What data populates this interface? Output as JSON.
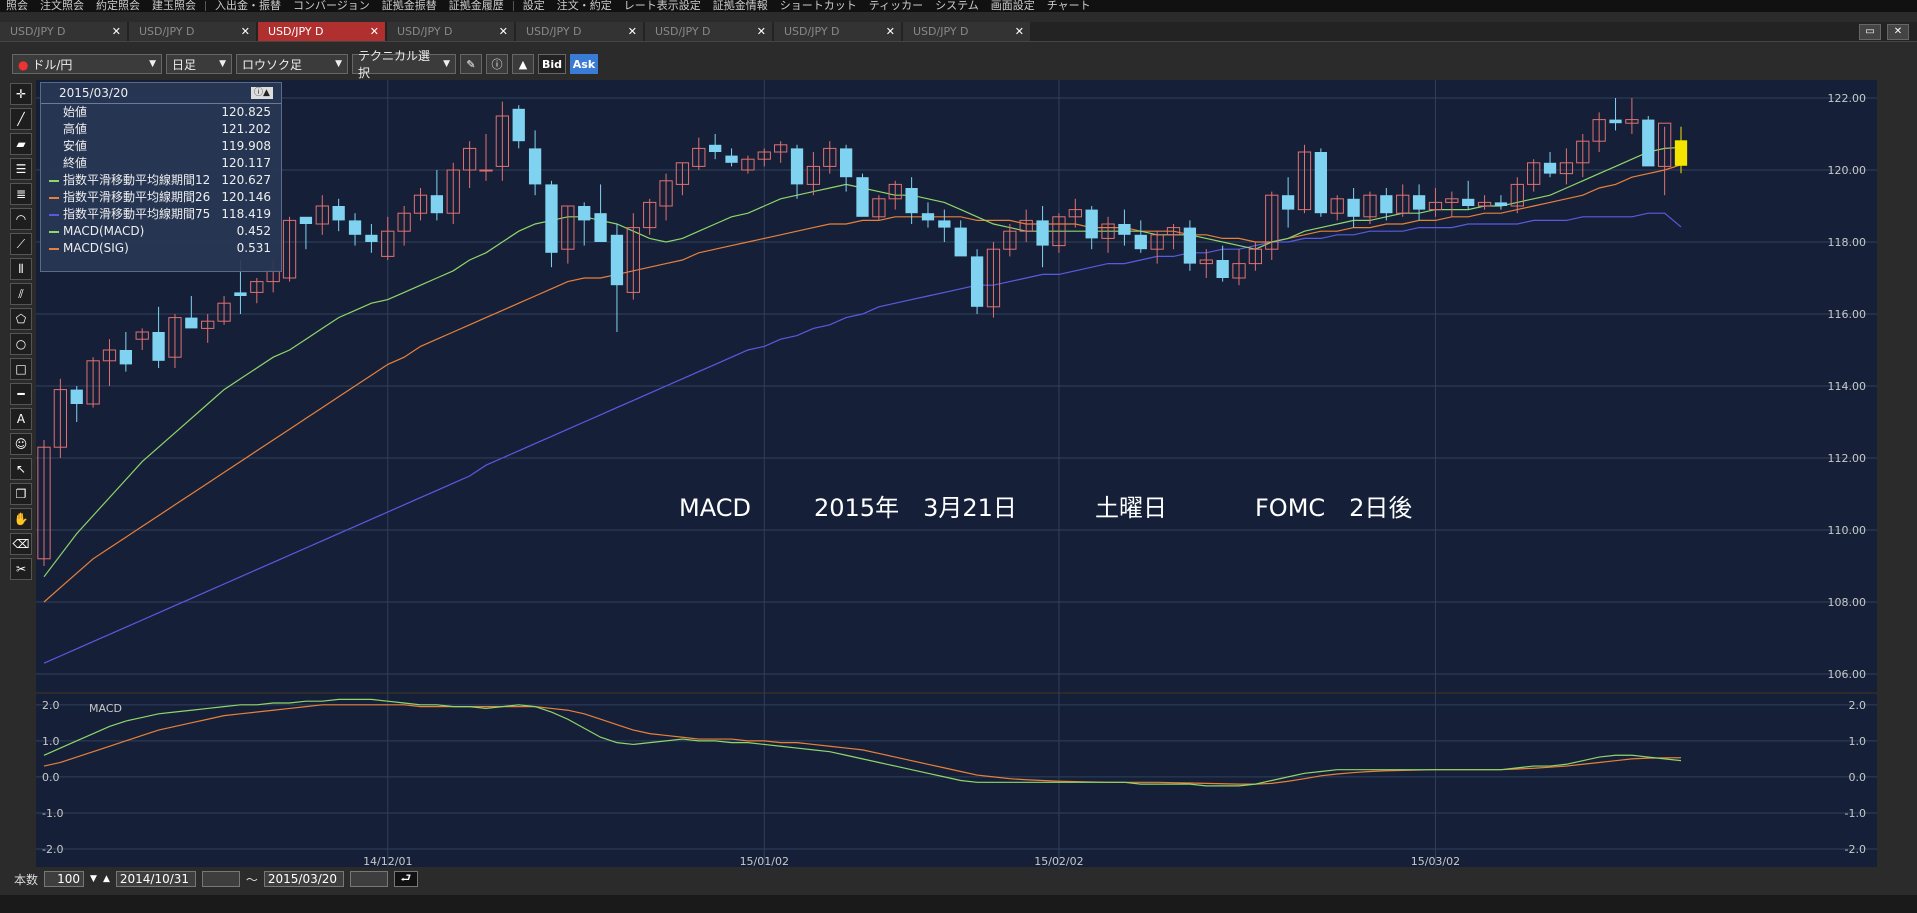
{
  "menu": [
    "照会",
    "注文照会",
    "約定照会",
    "建玉照会",
    "入出金・振替",
    "コンバージョン",
    "証拠金振替",
    "証拠金履歴",
    "設定",
    "注文・約定",
    "レート表示設定",
    "証拠金情報",
    "ショートカット",
    "ティッカー",
    "システム",
    "画面設定",
    "チャート"
  ],
  "tabs": [
    {
      "label": "USD/JPY D",
      "active": false
    },
    {
      "label": "USD/JPY D",
      "active": false
    },
    {
      "label": "USD/JPY D",
      "active": true
    },
    {
      "label": "USD/JPY D",
      "active": false
    },
    {
      "label": "USD/JPY D",
      "active": false
    },
    {
      "label": "USD/JPY D",
      "active": false
    },
    {
      "label": "USD/JPY D",
      "active": false
    },
    {
      "label": "USD/JPY D",
      "active": false
    }
  ],
  "toolbar": {
    "pair": "ドル/円",
    "period": "日足",
    "chart_type": "ロウソク足",
    "technical": "テクニカル選択",
    "bid": "Bid",
    "ask": "Ask"
  },
  "info": {
    "date": "2015/03/20",
    "rows": [
      {
        "label": "始値",
        "value": "120.825",
        "color": ""
      },
      {
        "label": "高値",
        "value": "121.202",
        "color": ""
      },
      {
        "label": "安値",
        "value": "119.908",
        "color": ""
      },
      {
        "label": "終値",
        "value": "120.117",
        "color": ""
      },
      {
        "label": "指数平滑移動平均線期間12",
        "value": "120.627",
        "color": "#8fd66a"
      },
      {
        "label": "指数平滑移動平均線期間26",
        "value": "120.146",
        "color": "#e8803a"
      },
      {
        "label": "指数平滑移動平均線期間75",
        "value": "118.419",
        "color": "#5a5ae0"
      },
      {
        "label": "MACD(MACD)",
        "value": "0.452",
        "color": "#8fd66a"
      },
      {
        "label": "MACD(SIG)",
        "value": "0.531",
        "color": "#e8803a"
      }
    ]
  },
  "annotation": {
    "macd": "MACD",
    "date": "2015年　3月21日",
    "weekday": "土曜日",
    "fomc": "FOMC　2日後"
  },
  "sub_label": "MACD",
  "bottom": {
    "count_label": "本数",
    "count": "100",
    "from": "2014/10/31",
    "tilde": "～",
    "to": "2015/03/20"
  },
  "colors": {
    "bg": "#152038",
    "grid": "#2f3f5c",
    "up": "#e07070",
    "down": "#7fd3f0",
    "ema12": "#8fd66a",
    "ema26": "#e8803a",
    "ema75": "#5a5ae0",
    "current": "#f5e400"
  },
  "chart_data": {
    "type": "candlestick",
    "ylim": [
      105.5,
      122.5
    ],
    "y_ticks": [
      "122.00",
      "120.00",
      "118.00",
      "116.00",
      "114.00",
      "112.00",
      "110.00",
      "108.00",
      "106.00"
    ],
    "x_ticks": [
      "14/12/01",
      "15/01/02",
      "15/02/02",
      "15/03/02"
    ],
    "sub_ylim": [
      -2.5,
      2.3
    ],
    "sub_y_ticks": [
      "2.0",
      "1.0",
      "0.0",
      "-1.0",
      "-2.0"
    ],
    "ohlc": [
      [
        109.2,
        112.5,
        109.0,
        112.3
      ],
      [
        112.3,
        114.2,
        112.0,
        113.9
      ],
      [
        113.9,
        114.0,
        113.0,
        113.5
      ],
      [
        113.5,
        114.8,
        113.4,
        114.7
      ],
      [
        114.7,
        115.3,
        114.0,
        115.0
      ],
      [
        115.0,
        115.5,
        114.4,
        114.6
      ],
      [
        115.3,
        115.6,
        115.0,
        115.5
      ],
      [
        115.5,
        116.2,
        114.5,
        114.7
      ],
      [
        114.8,
        116.0,
        114.5,
        115.9
      ],
      [
        115.9,
        116.5,
        115.7,
        115.6
      ],
      [
        115.6,
        116.0,
        115.2,
        115.8
      ],
      [
        115.8,
        116.5,
        115.7,
        116.3
      ],
      [
        116.6,
        117.5,
        116.0,
        116.5
      ],
      [
        116.6,
        117.0,
        116.3,
        116.9
      ],
      [
        116.9,
        117.5,
        116.6,
        117.2
      ],
      [
        117.0,
        118.7,
        116.9,
        118.6
      ],
      [
        118.7,
        118.6,
        117.8,
        118.5
      ],
      [
        118.5,
        119.3,
        118.2,
        119.0
      ],
      [
        119.0,
        119.2,
        118.3,
        118.6
      ],
      [
        118.6,
        118.8,
        117.9,
        118.2
      ],
      [
        118.2,
        118.5,
        117.7,
        118.0
      ],
      [
        117.6,
        118.7,
        117.5,
        118.3
      ],
      [
        118.3,
        119.0,
        117.9,
        118.8
      ],
      [
        118.8,
        119.5,
        118.6,
        119.3
      ],
      [
        119.3,
        120.0,
        118.6,
        118.8
      ],
      [
        118.8,
        120.2,
        118.5,
        120.0
      ],
      [
        120.0,
        120.8,
        119.5,
        120.6
      ],
      [
        120.0,
        121.0,
        119.7,
        120.0
      ],
      [
        120.1,
        121.9,
        119.7,
        121.5
      ],
      [
        121.7,
        121.8,
        120.6,
        120.8
      ],
      [
        120.6,
        121.1,
        119.3,
        119.6
      ],
      [
        119.6,
        119.7,
        117.3,
        117.7
      ],
      [
        117.8,
        119.0,
        117.4,
        119.0
      ],
      [
        119.0,
        119.1,
        117.9,
        118.6
      ],
      [
        118.8,
        119.6,
        118.3,
        118.0
      ],
      [
        118.2,
        118.5,
        115.5,
        116.8
      ],
      [
        116.6,
        118.8,
        116.4,
        118.4
      ],
      [
        118.4,
        119.2,
        118.2,
        119.1
      ],
      [
        119.0,
        119.9,
        118.6,
        119.7
      ],
      [
        119.6,
        120.2,
        119.3,
        120.2
      ],
      [
        120.1,
        120.9,
        120.0,
        120.6
      ],
      [
        120.7,
        121.0,
        120.3,
        120.5
      ],
      [
        120.4,
        120.6,
        120.1,
        120.2
      ],
      [
        120.0,
        120.4,
        119.9,
        120.3
      ],
      [
        120.3,
        120.6,
        120.1,
        120.5
      ],
      [
        120.5,
        120.8,
        120.2,
        120.7
      ],
      [
        120.6,
        120.7,
        119.2,
        119.6
      ],
      [
        119.6,
        120.5,
        119.3,
        120.1
      ],
      [
        120.1,
        120.8,
        119.9,
        120.6
      ],
      [
        120.6,
        120.7,
        119.4,
        119.8
      ],
      [
        119.8,
        119.9,
        118.8,
        118.7
      ],
      [
        118.7,
        119.3,
        118.6,
        119.2
      ],
      [
        119.2,
        119.7,
        118.9,
        119.6
      ],
      [
        119.5,
        119.8,
        118.5,
        118.8
      ],
      [
        118.8,
        119.1,
        118.4,
        118.6
      ],
      [
        118.6,
        118.9,
        118.0,
        118.4
      ],
      [
        118.4,
        118.6,
        117.7,
        117.6
      ],
      [
        117.6,
        117.8,
        116.0,
        116.2
      ],
      [
        116.2,
        118.0,
        115.9,
        117.8
      ],
      [
        117.8,
        118.5,
        117.6,
        118.3
      ],
      [
        118.3,
        118.9,
        118.0,
        118.6
      ],
      [
        118.6,
        119.0,
        117.3,
        117.9
      ],
      [
        117.9,
        118.8,
        117.7,
        118.7
      ],
      [
        118.7,
        119.2,
        118.4,
        118.9
      ],
      [
        118.9,
        119.0,
        117.8,
        118.1
      ],
      [
        118.1,
        118.7,
        117.7,
        118.5
      ],
      [
        118.5,
        118.9,
        117.9,
        118.2
      ],
      [
        118.2,
        118.6,
        117.7,
        117.8
      ],
      [
        117.8,
        118.3,
        117.4,
        118.2
      ],
      [
        118.2,
        118.5,
        117.8,
        118.4
      ],
      [
        118.4,
        118.6,
        117.2,
        117.4
      ],
      [
        117.4,
        117.8,
        117.0,
        117.5
      ],
      [
        117.5,
        117.9,
        116.9,
        117.0
      ],
      [
        117.0,
        117.8,
        116.8,
        117.4
      ],
      [
        117.4,
        118.0,
        117.2,
        117.8
      ],
      [
        117.8,
        119.4,
        117.5,
        119.3
      ],
      [
        119.3,
        119.8,
        118.4,
        118.9
      ],
      [
        118.9,
        120.7,
        118.8,
        120.5
      ],
      [
        120.5,
        120.6,
        118.7,
        118.8
      ],
      [
        118.8,
        119.3,
        118.6,
        119.2
      ],
      [
        119.2,
        119.5,
        118.4,
        118.7
      ],
      [
        118.7,
        119.4,
        118.5,
        119.3
      ],
      [
        119.3,
        119.5,
        118.6,
        118.8
      ],
      [
        118.8,
        119.6,
        118.7,
        119.3
      ],
      [
        119.3,
        119.6,
        118.6,
        118.9
      ],
      [
        118.9,
        119.5,
        118.7,
        119.1
      ],
      [
        119.1,
        119.4,
        118.7,
        119.2
      ],
      [
        119.2,
        119.7,
        118.9,
        119.0
      ],
      [
        119.0,
        119.3,
        118.9,
        119.1
      ],
      [
        119.1,
        119.3,
        118.9,
        119.0
      ],
      [
        119.0,
        119.8,
        118.8,
        119.6
      ],
      [
        119.6,
        120.3,
        119.4,
        120.2
      ],
      [
        120.2,
        120.5,
        119.8,
        119.9
      ],
      [
        119.9,
        120.6,
        119.6,
        120.2
      ],
      [
        120.2,
        121.0,
        119.8,
        120.8
      ],
      [
        120.8,
        121.6,
        120.5,
        121.4
      ],
      [
        121.4,
        122.0,
        121.1,
        121.3
      ],
      [
        121.3,
        122.0,
        121.0,
        121.4
      ],
      [
        121.4,
        121.5,
        120.7,
        120.1
      ],
      [
        120.1,
        121.2,
        119.3,
        121.3
      ],
      [
        120.825,
        121.202,
        119.908,
        120.117
      ]
    ],
    "ema12": [
      108.7,
      109.3,
      109.9,
      110.4,
      110.9,
      111.4,
      111.9,
      112.3,
      112.7,
      113.1,
      113.5,
      113.9,
      114.2,
      114.5,
      114.8,
      115.0,
      115.3,
      115.6,
      115.9,
      116.1,
      116.3,
      116.4,
      116.6,
      116.8,
      117.0,
      117.2,
      117.5,
      117.7,
      118.0,
      118.3,
      118.5,
      118.6,
      118.7,
      118.7,
      118.6,
      118.5,
      118.3,
      118.1,
      118.0,
      118.1,
      118.3,
      118.5,
      118.7,
      118.8,
      119.0,
      119.2,
      119.3,
      119.4,
      119.5,
      119.6,
      119.5,
      119.4,
      119.3,
      119.3,
      119.2,
      119.1,
      118.9,
      118.7,
      118.5,
      118.4,
      118.3,
      118.3,
      118.3,
      118.3,
      118.3,
      118.3,
      118.3,
      118.3,
      118.2,
      118.2,
      118.2,
      118.1,
      118.0,
      117.9,
      117.8,
      118.0,
      118.1,
      118.3,
      118.4,
      118.5,
      118.6,
      118.6,
      118.7,
      118.8,
      118.8,
      118.9,
      118.9,
      118.9,
      119.0,
      119.0,
      119.1,
      119.2,
      119.3,
      119.5,
      119.7,
      119.9,
      120.1,
      120.3,
      120.5,
      120.6,
      120.627
    ],
    "ema26": [
      108.0,
      108.4,
      108.8,
      109.2,
      109.5,
      109.8,
      110.1,
      110.4,
      110.7,
      111.0,
      111.3,
      111.6,
      111.9,
      112.2,
      112.5,
      112.8,
      113.1,
      113.4,
      113.7,
      114.0,
      114.3,
      114.6,
      114.8,
      115.1,
      115.3,
      115.5,
      115.7,
      115.9,
      116.1,
      116.3,
      116.5,
      116.7,
      116.9,
      117.0,
      117.0,
      117.1,
      117.2,
      117.3,
      117.4,
      117.5,
      117.7,
      117.8,
      117.9,
      118.0,
      118.1,
      118.2,
      118.3,
      118.4,
      118.5,
      118.5,
      118.6,
      118.6,
      118.7,
      118.7,
      118.7,
      118.7,
      118.7,
      118.6,
      118.6,
      118.6,
      118.5,
      118.5,
      118.5,
      118.5,
      118.4,
      118.4,
      118.4,
      118.3,
      118.3,
      118.3,
      118.2,
      118.2,
      118.1,
      118.1,
      118.0,
      118.0,
      118.1,
      118.2,
      118.3,
      118.3,
      118.4,
      118.4,
      118.5,
      118.5,
      118.6,
      118.6,
      118.7,
      118.7,
      118.8,
      118.8,
      118.9,
      119.0,
      119.1,
      119.2,
      119.3,
      119.5,
      119.6,
      119.8,
      119.9,
      120.0,
      120.146
    ],
    "ema75": [
      106.3,
      106.5,
      106.7,
      106.9,
      107.1,
      107.3,
      107.5,
      107.7,
      107.9,
      108.1,
      108.3,
      108.5,
      108.7,
      108.9,
      109.1,
      109.3,
      109.5,
      109.7,
      109.9,
      110.1,
      110.3,
      110.5,
      110.7,
      110.9,
      111.1,
      111.3,
      111.5,
      111.8,
      112.0,
      112.2,
      112.4,
      112.6,
      112.8,
      113.0,
      113.2,
      113.4,
      113.6,
      113.8,
      114.0,
      114.2,
      114.4,
      114.6,
      114.8,
      115.0,
      115.1,
      115.3,
      115.4,
      115.6,
      115.7,
      115.9,
      116.0,
      116.2,
      116.3,
      116.4,
      116.5,
      116.6,
      116.7,
      116.8,
      116.8,
      116.9,
      117.0,
      117.1,
      117.1,
      117.2,
      117.3,
      117.4,
      117.4,
      117.5,
      117.6,
      117.6,
      117.7,
      117.7,
      117.8,
      117.8,
      117.9,
      118.0,
      118.0,
      118.1,
      118.1,
      118.2,
      118.2,
      118.3,
      118.3,
      118.3,
      118.4,
      118.4,
      118.4,
      118.5,
      118.5,
      118.5,
      118.5,
      118.6,
      118.6,
      118.6,
      118.7,
      118.7,
      118.7,
      118.7,
      118.8,
      118.8,
      118.419
    ],
    "macd": [
      0.6,
      0.8,
      1.0,
      1.2,
      1.4,
      1.55,
      1.65,
      1.75,
      1.8,
      1.85,
      1.9,
      1.95,
      2.0,
      2.0,
      2.05,
      2.05,
      2.1,
      2.1,
      2.15,
      2.15,
      2.15,
      2.1,
      2.05,
      2.0,
      2.0,
      1.95,
      1.95,
      1.9,
      1.95,
      2.0,
      1.95,
      1.8,
      1.6,
      1.35,
      1.1,
      0.95,
      0.9,
      0.95,
      1.0,
      1.05,
      1.0,
      1.0,
      0.95,
      0.95,
      0.9,
      0.85,
      0.8,
      0.75,
      0.7,
      0.6,
      0.5,
      0.4,
      0.3,
      0.2,
      0.1,
      0.0,
      -0.1,
      -0.15,
      -0.15,
      -0.15,
      -0.15,
      -0.15,
      -0.15,
      -0.15,
      -0.15,
      -0.15,
      -0.15,
      -0.2,
      -0.2,
      -0.2,
      -0.2,
      -0.25,
      -0.25,
      -0.25,
      -0.2,
      -0.1,
      0.0,
      0.1,
      0.15,
      0.2,
      0.2,
      0.2,
      0.2,
      0.2,
      0.2,
      0.2,
      0.2,
      0.2,
      0.2,
      0.2,
      0.25,
      0.3,
      0.3,
      0.35,
      0.45,
      0.55,
      0.6,
      0.6,
      0.55,
      0.5,
      0.452
    ],
    "sig": [
      0.3,
      0.4,
      0.55,
      0.7,
      0.85,
      1.0,
      1.15,
      1.3,
      1.4,
      1.5,
      1.6,
      1.7,
      1.75,
      1.8,
      1.85,
      1.9,
      1.95,
      2.0,
      2.0,
      2.0,
      2.0,
      2.0,
      2.0,
      1.95,
      1.95,
      1.95,
      1.95,
      1.95,
      1.95,
      1.95,
      1.95,
      1.9,
      1.85,
      1.75,
      1.6,
      1.45,
      1.3,
      1.2,
      1.15,
      1.1,
      1.05,
      1.05,
      1.05,
      1.0,
      1.0,
      0.95,
      0.95,
      0.9,
      0.85,
      0.8,
      0.75,
      0.65,
      0.55,
      0.45,
      0.35,
      0.25,
      0.15,
      0.05,
      0.0,
      -0.05,
      -0.08,
      -0.1,
      -0.12,
      -0.13,
      -0.14,
      -0.15,
      -0.15,
      -0.15,
      -0.15,
      -0.16,
      -0.17,
      -0.18,
      -0.19,
      -0.2,
      -0.2,
      -0.18,
      -0.12,
      -0.05,
      0.03,
      0.08,
      0.12,
      0.15,
      0.17,
      0.18,
      0.19,
      0.2,
      0.2,
      0.2,
      0.2,
      0.2,
      0.22,
      0.24,
      0.27,
      0.3,
      0.35,
      0.4,
      0.45,
      0.5,
      0.52,
      0.53,
      0.531
    ]
  }
}
